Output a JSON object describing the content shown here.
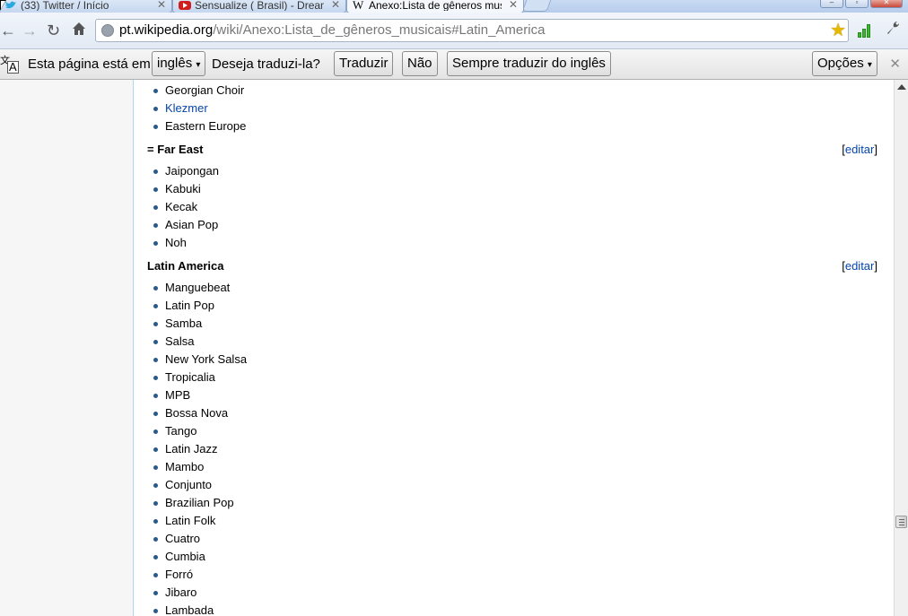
{
  "tabs": [
    {
      "label": "(33) Twitter / Início",
      "icon": "twitter-icon",
      "active": false
    },
    {
      "label": "Sensualize ( Brasil) - Dreami",
      "icon": "youtube-icon",
      "active": false
    },
    {
      "label": "Anexo:Lista de gêneros mus",
      "icon": "wikipedia-icon",
      "active": true
    }
  ],
  "omnibox": {
    "host": "pt.wikipedia.org",
    "path": "/wiki/Anexo:Lista_de_gêneros_musicais#Latin_America"
  },
  "translate": {
    "prompt": "Esta página está em",
    "language": "inglês",
    "question": "Deseja traduzi-la?",
    "translate_btn": "Traduzir",
    "no_btn": "Não",
    "always_btn": "Sempre traduzir do inglês",
    "options_btn": "Opções",
    "close": "✕"
  },
  "article": {
    "top_list": [
      {
        "label": "Georgian Choir",
        "link": false
      },
      {
        "label": "Klezmer",
        "link": true
      },
      {
        "label": "Eastern Europe",
        "link": false
      }
    ],
    "far_east": {
      "heading": "= Far East",
      "edit": "editar",
      "items": [
        "Jaipongan",
        "Kabuki",
        "Kecak",
        "Asian Pop",
        "Noh"
      ]
    },
    "latin_america": {
      "heading": "Latin America",
      "edit": "editar",
      "items": [
        "Manguebeat",
        "Latin Pop",
        "Samba",
        "Salsa",
        "New York Salsa",
        "Tropicalia",
        "MPB",
        "Bossa Nova",
        "Tango",
        "Latin Jazz",
        "Mambo",
        "Conjunto",
        "Brazilian Pop",
        "Latin Folk",
        "Cuatro",
        "Cumbia",
        "Forró",
        "Jibaro",
        "Lambada"
      ]
    }
  },
  "colors": {
    "link": "#0645ad",
    "bullet": "#2a5a8a",
    "sidebar_border": "#a7d7f9"
  }
}
